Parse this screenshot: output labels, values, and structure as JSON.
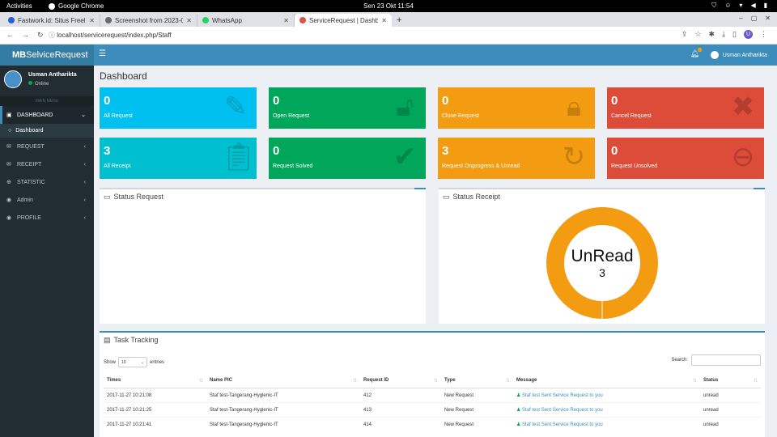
{
  "os": {
    "activities": "Activities",
    "app_name": "Google Chrome",
    "clock": "Sen 23 Okt  11:54"
  },
  "browser": {
    "tabs": [
      {
        "title": "Fastwork.id: Situs Freelan",
        "color": "#2b5fd9"
      },
      {
        "title": "Screenshot from 2023-0",
        "color": "#6b6b6b"
      },
      {
        "title": "WhatsApp",
        "color": "#25d366"
      },
      {
        "title": "ServiceRequest | Dashb",
        "color": "#d9534f"
      }
    ],
    "url": "localhost/servicerequest/index.php/Staff",
    "profile_letter": "U"
  },
  "sidebar": {
    "logo_bold": "MB",
    "logo_rest": "SelviceRequest",
    "user_name": "Usman Antharikta",
    "user_status": "Online",
    "main_menu": "MAIN MENU",
    "items": [
      {
        "label": "DASHBOARD",
        "icon": "dashboard-icon",
        "glyph": "▣"
      },
      {
        "label": "Dashboard",
        "icon": "circle-icon",
        "glyph": "○"
      },
      {
        "label": "REQUEST",
        "icon": "envelope-icon",
        "glyph": "✉"
      },
      {
        "label": "RECEIPT",
        "icon": "receipt-icon",
        "glyph": "✉"
      },
      {
        "label": "STATISTIC",
        "icon": "globe-icon",
        "glyph": "⊕"
      },
      {
        "label": "Admin",
        "icon": "user-circle-icon",
        "glyph": "◉"
      },
      {
        "label": "PROFILE",
        "icon": "user-circle-icon",
        "glyph": "◉"
      }
    ]
  },
  "header": {
    "user": "Usman Antharikta"
  },
  "page": {
    "title": "Dashboard"
  },
  "stats": [
    {
      "value": "0",
      "label": "All Request",
      "color": "#00c0ef",
      "icon": "edit-icon"
    },
    {
      "value": "0",
      "label": "Open Request",
      "color": "#00a65a",
      "icon": "unlock-icon"
    },
    {
      "value": "0",
      "label": "Close Request",
      "color": "#f39c12",
      "icon": "lock-icon"
    },
    {
      "value": "0",
      "label": "Cancel Request",
      "color": "#dd4b39",
      "icon": "times-circle-icon"
    },
    {
      "value": "3",
      "label": "All Receipt",
      "color": "#00c0cf",
      "icon": "clipboard-icon"
    },
    {
      "value": "0",
      "label": "Request Solved",
      "color": "#00a65a",
      "icon": "check-icon"
    },
    {
      "value": "3",
      "label": "Request Onprogress & Unread",
      "color": "#f39c12",
      "icon": "refresh-icon"
    },
    {
      "value": "0",
      "label": "Request Unsolved",
      "color": "#dd4b39",
      "icon": "minus-circle-icon"
    }
  ],
  "panels": {
    "status_request": "Status Request",
    "status_receipt": "Status Receipt"
  },
  "chart_data": {
    "type": "pie",
    "categories": [
      "UnRead"
    ],
    "values": [
      3
    ],
    "center_label": "UnRead",
    "center_value": "3",
    "colors": [
      "#f39c12"
    ]
  },
  "task": {
    "title": "Task Tracking",
    "show": "Show",
    "entries_value": "10",
    "entries": "entries",
    "search": "Search:",
    "columns": [
      "Times",
      "Name PIC",
      "Request ID",
      "Type",
      "Message",
      "Status"
    ],
    "rows": [
      {
        "time": "2017-11-27 10:21:08",
        "pic": "Staf test-Tangerang-Hyglenic-IT",
        "id": "412",
        "type": "New Request",
        "message": "Staf test Sent Service Request to you",
        "status": "unread"
      },
      {
        "time": "2017-11-27 10:21:25",
        "pic": "Staf test-Tangerang-Hyglenic-IT",
        "id": "413",
        "type": "New Request",
        "message": "Staf test Sent Service Request to you",
        "status": "unread"
      },
      {
        "time": "2017-11-27 10:21:41",
        "pic": "Staf test-Tangerang-Hyglenic-IT",
        "id": "414",
        "type": "New Request",
        "message": "Staf test Sent Service Request to you",
        "status": "unread"
      }
    ]
  }
}
